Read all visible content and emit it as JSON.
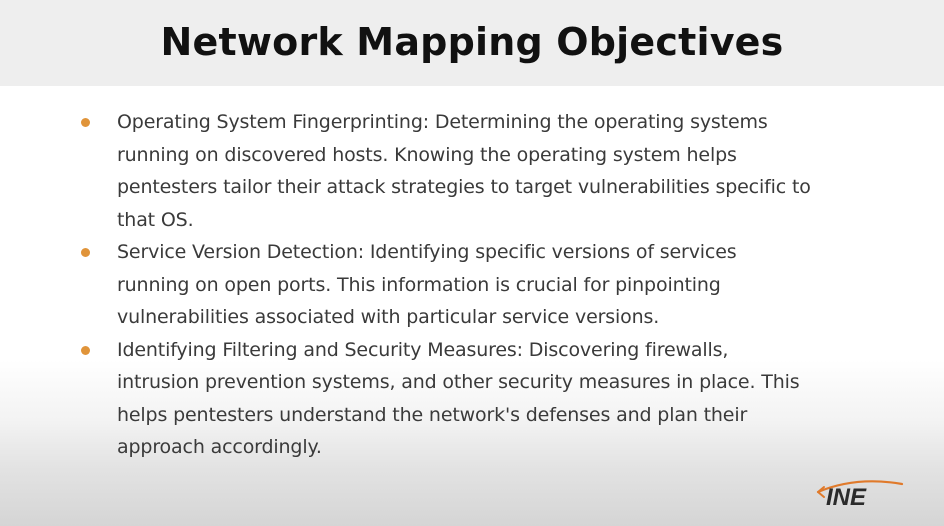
{
  "slide": {
    "title": "Network Mapping Objectives",
    "bullets": [
      {
        "lines": [
          "Operating System Fingerprinting: Determining the operating systems",
          "running on discovered hosts. Knowing the operating system helps",
          "pentesters tailor their attack strategies to target vulnerabilities specific to",
          "that OS."
        ]
      },
      {
        "lines": [
          "Service Version Detection: Identifying specific versions of services",
          "running on open ports. This information is crucial for pinpointing",
          "vulnerabilities associated with particular service versions."
        ]
      },
      {
        "lines": [
          "Identifying Filtering and Security Measures: Discovering firewalls,",
          "intrusion prevention systems, and other security measures in place. This",
          "helps pentesters understand the network's defenses and plan their",
          "approach accordingly."
        ]
      }
    ]
  },
  "logo": {
    "text": "INE",
    "icon": "ine-logo-icon"
  },
  "colors": {
    "bullet": "#e0943a",
    "title": "#111111",
    "body_text": "#3a3a3a",
    "title_bar": "#eeeeee",
    "logo_dark": "#2b2b2b",
    "logo_accent": "#e07a2b"
  }
}
